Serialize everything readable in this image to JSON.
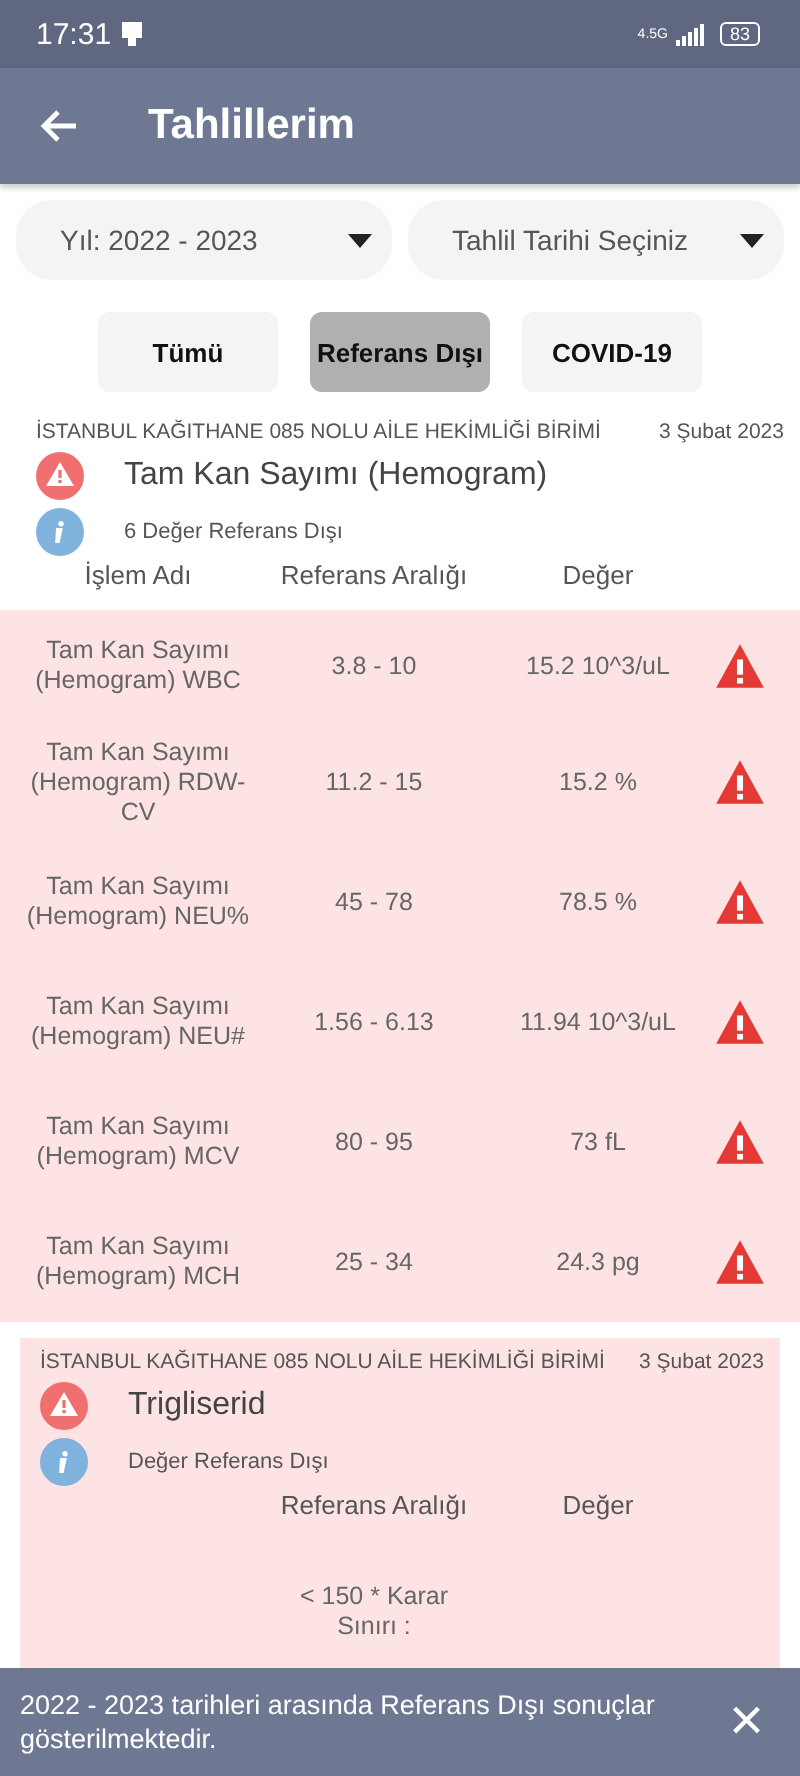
{
  "status_bar": {
    "time": "17:31",
    "network": "4.5G",
    "battery": "83"
  },
  "app_bar": {
    "title": "Tahlillerim"
  },
  "dropdowns": [
    {
      "value": "Yıl: 2022 - 2023"
    },
    {
      "value": "Tahlil Tarihi Seçiniz"
    }
  ],
  "filters": [
    {
      "label": "Tümü",
      "selected": false
    },
    {
      "label": "Referans Dışı",
      "selected": true
    },
    {
      "label": "COVID-19",
      "selected": false
    }
  ],
  "results": [
    {
      "facility": "İSTANBUL KAĞITHANE 085 NOLU AİLE HEKİMLİĞİ BİRİMİ",
      "date": "3 Şubat 2023",
      "title": "Tam Kan Sayımı (Hemogram)",
      "summary": "6 Değer Referans Dışı",
      "highlighted": false,
      "header": {
        "name": "İşlem Adı",
        "reference": "Referans Aralığı",
        "value": "Değer"
      },
      "rows": [
        {
          "name": "Tam Kan Sayımı (Hemogram) WBC",
          "reference": "3.8 - 10",
          "value": "15.2 10^3/uL",
          "alert": true
        },
        {
          "name": "Tam Kan Sayımı (Hemogram) RDW-CV",
          "reference": "11.2 - 15",
          "value": "15.2 %",
          "alert": true
        },
        {
          "name": "Tam Kan Sayımı (Hemogram) NEU%",
          "reference": "45 - 78",
          "value": "78.5 %",
          "alert": true
        },
        {
          "name": "Tam Kan Sayımı (Hemogram) NEU#",
          "reference": "1.56 - 6.13",
          "value": "11.94 10^3/uL",
          "alert": true
        },
        {
          "name": "Tam Kan Sayımı (Hemogram) MCV",
          "reference": "80 - 95",
          "value": "73 fL",
          "alert": true
        },
        {
          "name": "Tam Kan Sayımı (Hemogram) MCH",
          "reference": "25 - 34",
          "value": "24.3 pg",
          "alert": true
        }
      ]
    },
    {
      "facility": "İSTANBUL KAĞITHANE 085 NOLU AİLE HEKİMLİĞİ BİRİMİ",
      "date": "3 Şubat 2023",
      "title": "Trigliserid",
      "summary": "Değer Referans Dışı",
      "highlighted": true,
      "header": {
        "reference": "Referans Aralığı",
        "value": "Değer"
      },
      "rows": [
        {
          "reference": "< 150 * Karar Sınırı :",
          "alert": false
        }
      ]
    }
  ],
  "snackbar": {
    "message": "2022 - 2023 tarihleri arasında Referans Dışı sonuçlar gösterilmektedir.",
    "close": "×"
  }
}
